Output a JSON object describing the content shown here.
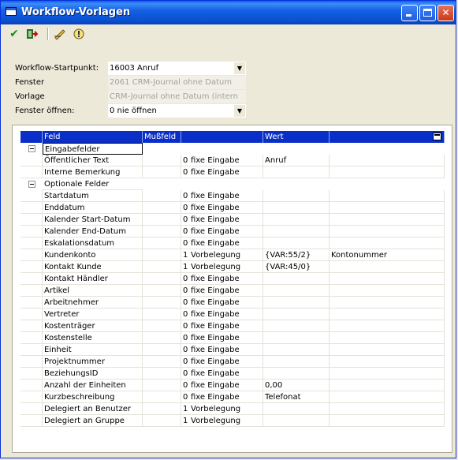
{
  "window": {
    "title": "Workflow-Vorlagen",
    "accent": "#0a4fd0"
  },
  "toolbar": {
    "icons": [
      "checkmark-icon",
      "exit-icon",
      "edit-icon",
      "info-icon"
    ]
  },
  "form": {
    "startpunkt": {
      "label": "Workflow-Startpunkt:",
      "value": "16003 Anruf"
    },
    "fenster": {
      "label": "Fenster",
      "value": "2061 CRM-Journal ohne Datum"
    },
    "vorlage": {
      "label": "Vorlage",
      "value": "CRM-Journal ohne Datum (intern"
    },
    "fenster_oeffnen": {
      "label": "Fenster öffnen:",
      "value": "0 nie öffnen"
    }
  },
  "grid": {
    "headers": {
      "feld": "Feld",
      "mussfeld": "Mußfeld",
      "wert": "Wert"
    },
    "header_color": "#0a2fc8",
    "groups": [
      {
        "title": "Eingabefelder",
        "rows": [
          {
            "feld": "Öffentlicher Text",
            "num": "0",
            "mode": "fixe Eingabe",
            "wert": "Anruf",
            "extra": ""
          },
          {
            "feld": "Interne Bemerkung",
            "num": "0",
            "mode": "fixe Eingabe",
            "wert": "",
            "extra": ""
          }
        ]
      },
      {
        "title": "Optionale Felder",
        "rows": [
          {
            "feld": "Startdatum",
            "num": "0",
            "mode": "fixe Eingabe",
            "wert": "",
            "extra": ""
          },
          {
            "feld": "Enddatum",
            "num": "0",
            "mode": "fixe Eingabe",
            "wert": "",
            "extra": ""
          },
          {
            "feld": "Kalender Start-Datum",
            "num": "0",
            "mode": "fixe Eingabe",
            "wert": "",
            "extra": ""
          },
          {
            "feld": "Kalender End-Datum",
            "num": "0",
            "mode": "fixe Eingabe",
            "wert": "",
            "extra": ""
          },
          {
            "feld": "Eskalationsdatum",
            "num": "0",
            "mode": "fixe Eingabe",
            "wert": "",
            "extra": ""
          },
          {
            "feld": "Kundenkonto",
            "num": "1",
            "mode": "Vorbelegung",
            "wert": "{VAR:55/2}",
            "extra": "Kontonummer"
          },
          {
            "feld": "Kontakt Kunde",
            "num": "1",
            "mode": "Vorbelegung",
            "wert": "{VAR:45/0}",
            "extra": ""
          },
          {
            "feld": "Kontakt Händler",
            "num": "0",
            "mode": "fixe Eingabe",
            "wert": "",
            "extra": ""
          },
          {
            "feld": "Artikel",
            "num": "0",
            "mode": "fixe Eingabe",
            "wert": "",
            "extra": ""
          },
          {
            "feld": "Arbeitnehmer",
            "num": "0",
            "mode": "fixe Eingabe",
            "wert": "",
            "extra": ""
          },
          {
            "feld": "Vertreter",
            "num": "0",
            "mode": "fixe Eingabe",
            "wert": "",
            "extra": ""
          },
          {
            "feld": "Kostenträger",
            "num": "0",
            "mode": "fixe Eingabe",
            "wert": "",
            "extra": ""
          },
          {
            "feld": "Kostenstelle",
            "num": "0",
            "mode": "fixe Eingabe",
            "wert": "",
            "extra": ""
          },
          {
            "feld": "Einheit",
            "num": "0",
            "mode": "fixe Eingabe",
            "wert": "",
            "extra": ""
          },
          {
            "feld": "Projektnummer",
            "num": "0",
            "mode": "fixe Eingabe",
            "wert": "",
            "extra": ""
          },
          {
            "feld": "BeziehungsID",
            "num": "0",
            "mode": "fixe Eingabe",
            "wert": "",
            "extra": ""
          },
          {
            "feld": "Anzahl der Einheiten",
            "num": "0",
            "mode": "fixe Eingabe",
            "wert": "0,00",
            "extra": ""
          },
          {
            "feld": "Kurzbeschreibung",
            "num": "0",
            "mode": "fixe Eingabe",
            "wert": "Telefonat",
            "extra": ""
          },
          {
            "feld": "Delegiert an Benutzer",
            "num": "1",
            "mode": "Vorbelegung",
            "wert": "",
            "extra": ""
          },
          {
            "feld": "Delegiert an Gruppe",
            "num": "1",
            "mode": "Vorbelegung",
            "wert": "",
            "extra": ""
          }
        ]
      }
    ]
  }
}
